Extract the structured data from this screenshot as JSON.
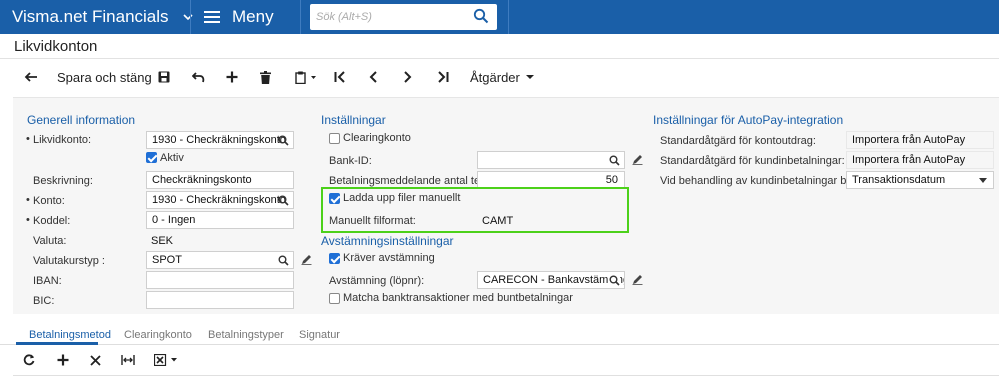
{
  "topbar": {
    "app_title": "Visma.net Financials",
    "menu_label": "Meny",
    "search_placeholder": "Sök (Alt+S)"
  },
  "page": {
    "title": "Likvidkonton"
  },
  "toolbar": {
    "save_close_label": "Spara och stäng",
    "actions_label": "Åtgärder"
  },
  "general": {
    "heading": "Generell information",
    "account_label": "Likvidkonto:",
    "account_value": "1930 - Checkräkningskonto",
    "active_label": "Aktiv",
    "description_label": "Beskrivning:",
    "description_value": "Checkräkningskonto",
    "konto_label": "Konto:",
    "konto_value": "1930 - Checkräkningskonto",
    "koddel_label": "Koddel:",
    "koddel_value": "0 - Ingen",
    "currency_label": "Valuta:",
    "currency_value": "SEK",
    "ratetype_label": "Valutakurstyp :",
    "ratetype_value": "SPOT",
    "iban_label": "IBAN:",
    "iban_value": "",
    "bic_label": "BIC:",
    "bic_value": ""
  },
  "settings": {
    "heading": "Inställningar",
    "clearing_label": "Clearingkonto",
    "bankid_label": "Bank-ID:",
    "bankid_value": "",
    "paymsg_label": "Betalningsmeddelande antal tecken:",
    "paymsg_value": "50",
    "upload_label": "Ladda upp filer manuellt",
    "fileformat_label": "Manuellt filformat:",
    "fileformat_value": "CAMT"
  },
  "reconciliation": {
    "heading": "Avstämningsinställningar",
    "requires_label": "Kräver avstämning",
    "numbering_label": "Avstämning (löpnr):",
    "numbering_value": "CARECON - Bankavstämningar",
    "match_label": "Matcha banktransaktioner med buntbetalningar"
  },
  "autopay": {
    "heading": "Inställningar för AutoPay-integration",
    "std_account_label": "Standardåtgärd för kontoutdrag:",
    "std_account_value": "Importera från AutoPay",
    "std_customer_label": "Standardåtgärd för kundinbetalningar:",
    "std_customer_value": "Importera från AutoPay",
    "booking_label": "Vid behandling av kundinbetalningar bokförs...",
    "booking_value": "Transaktionsdatum"
  },
  "tabs": [
    "Betalningsmetod",
    "Clearingkonto",
    "Betalningstyper",
    "Signatur"
  ],
  "colors": {
    "brand": "#1a5fa8",
    "highlight": "#4cd11a",
    "checkbox": "#1f6fd6"
  },
  "checkbox_states": {
    "active": true,
    "clearing": false,
    "upload": true,
    "requires": true,
    "match": false
  }
}
